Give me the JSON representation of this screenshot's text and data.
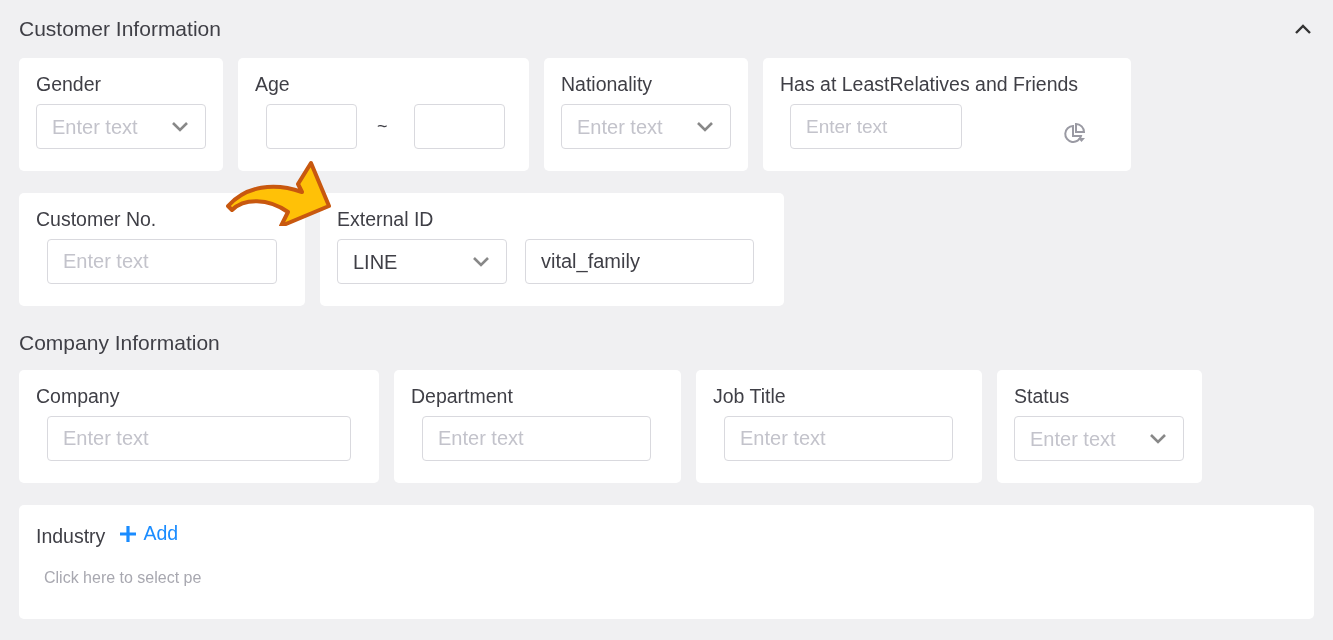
{
  "sections": [
    {
      "title": "Customer Information",
      "expanded": true,
      "fields": [
        {
          "kind": "select",
          "label": "Gender",
          "placeholder": "Enter text"
        },
        {
          "kind": "range",
          "label": "Age",
          "separator": "~"
        },
        {
          "kind": "select",
          "label": "Nationality",
          "placeholder": "Enter text"
        },
        {
          "kind": "text_icon",
          "label": "Has at LeastRelatives and Friends",
          "placeholder": "Enter text"
        },
        {
          "kind": "text",
          "label": "Customer No.",
          "placeholder": "Enter text"
        },
        {
          "kind": "select_text",
          "label": "External ID",
          "select_value": "LINE",
          "value": "vital_family"
        }
      ]
    },
    {
      "title": "Company Information",
      "fields": [
        {
          "kind": "text",
          "label": "Company",
          "placeholder": "Enter text"
        },
        {
          "kind": "text",
          "label": "Department",
          "placeholder": "Enter text"
        },
        {
          "kind": "text",
          "label": "Job Title",
          "placeholder": "Enter text"
        },
        {
          "kind": "select",
          "label": "Status",
          "placeholder": "Enter text"
        },
        {
          "kind": "tags",
          "label": "Industry",
          "add_label": "Add",
          "hint": "Click here to select pe"
        }
      ]
    }
  ]
}
